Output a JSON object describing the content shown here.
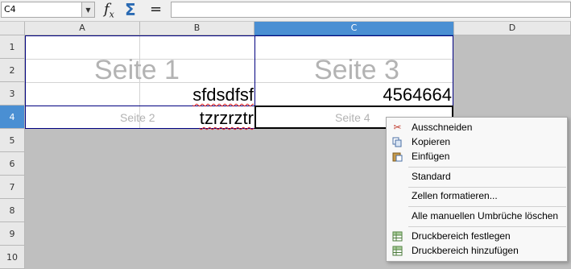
{
  "formula_bar": {
    "name_box": "C4",
    "dropdown_icon": "chevron-down-icon",
    "function_wizard_icon": "fx-icon",
    "sum_icon": "sigma-icon",
    "formula_icon": "equals-icon",
    "input_value": ""
  },
  "columns": [
    "A",
    "B",
    "C",
    "D"
  ],
  "rows": [
    "1",
    "2",
    "3",
    "4",
    "5",
    "6",
    "7",
    "8",
    "9",
    "10"
  ],
  "selected": {
    "column": "C",
    "row": "4"
  },
  "page_watermarks": {
    "page1": "Seite 1",
    "page2": "Seite 2",
    "page3": "Seite 3",
    "page4": "Seite 4"
  },
  "cells": {
    "B3": "sfdsdfsf",
    "B4": "tzrzrztr",
    "C3": "4564664"
  },
  "context_menu": {
    "items": [
      {
        "label": "Ausschneiden",
        "icon": "scissors-icon"
      },
      {
        "label": "Kopieren",
        "icon": "copy-icon"
      },
      {
        "label": "Einfügen",
        "icon": "paste-icon"
      },
      {
        "label": "Standard",
        "icon": ""
      },
      {
        "label": "Zellen formatieren...",
        "icon": ""
      },
      {
        "label": "Alle manuellen Umbrüche löschen",
        "icon": ""
      },
      {
        "label": "Druckbereich festlegen",
        "icon": "table-icon"
      },
      {
        "label": "Druckbereich hinzufügen",
        "icon": "table-icon"
      }
    ]
  },
  "colors": {
    "selection_header": "#4a8fd3",
    "page_border": "#000080",
    "watermark": "#b3b3b3",
    "background": "#bfbfbf"
  }
}
